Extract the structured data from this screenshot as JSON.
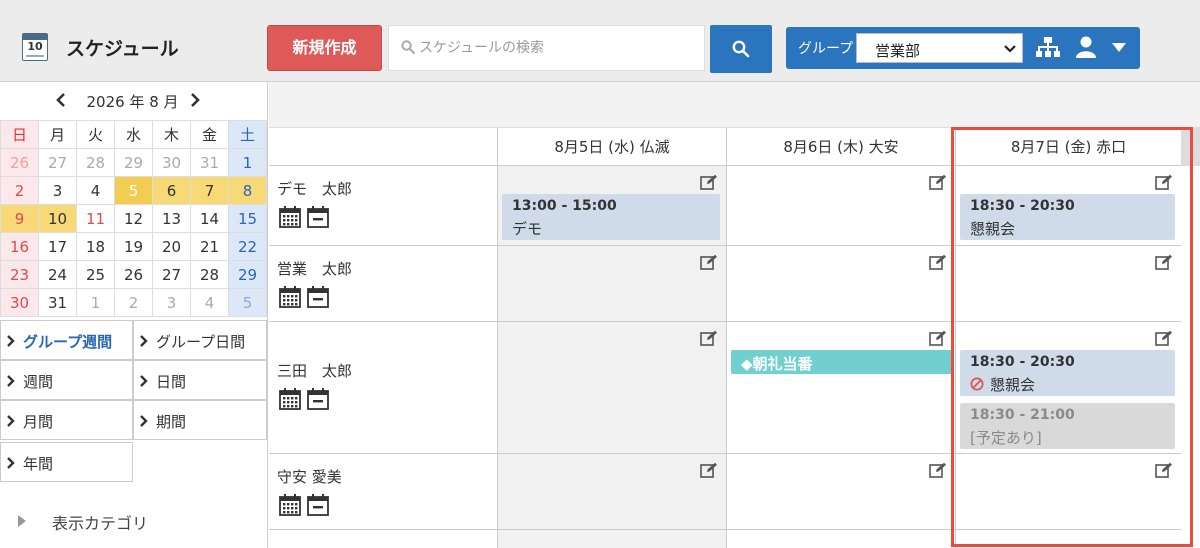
{
  "header": {
    "app_icon": {
      "name": "calendar-icon",
      "day": "10"
    },
    "title": "スケジュール",
    "new_button": "新規作成",
    "search": {
      "placeholder": "スケジュールの検索",
      "value": ""
    },
    "group_label": "グループ",
    "group_value": "営業部"
  },
  "mini_calendar": {
    "year": "2026",
    "month": "8",
    "label": "2026 年 8 月",
    "weekdays": [
      "日",
      "月",
      "火",
      "水",
      "木",
      "金",
      "土"
    ],
    "weeks": [
      [
        "26",
        "27",
        "28",
        "29",
        "30",
        "31",
        "1"
      ],
      [
        "2",
        "3",
        "4",
        "5",
        "6",
        "7",
        "8"
      ],
      [
        "9",
        "10",
        "11",
        "12",
        "13",
        "14",
        "15"
      ],
      [
        "16",
        "17",
        "18",
        "19",
        "20",
        "21",
        "22"
      ],
      [
        "23",
        "24",
        "25",
        "26",
        "27",
        "28",
        "29"
      ],
      [
        "30",
        "31",
        "1",
        "2",
        "3",
        "4",
        "5"
      ]
    ]
  },
  "view_menu": {
    "group_week": "グループ週間",
    "group_day": "グループ日間",
    "week": "週間",
    "day": "日間",
    "month": "月間",
    "period": "期間",
    "year": "年間"
  },
  "category_label": "表示カテゴリ",
  "days": [
    "8月5日 (水) 仏滅",
    "8月6日 (木) 大安",
    "8月7日 (金) 赤口"
  ],
  "rows": [
    {
      "name": "デモ　太郎",
      "events": {
        "d0": {
          "time": "13:00 - 15:00",
          "title": "デモ"
        },
        "d2": {
          "time": "18:30 - 20:30",
          "title": "懇親会"
        }
      }
    },
    {
      "name": "営業　太郎"
    },
    {
      "name": "三田　太郎",
      "events": {
        "d1": {
          "title": "◆朝礼当番"
        },
        "d2a": {
          "time": "18:30 - 20:30",
          "title": "懇親会"
        },
        "d2b": {
          "time": "18:30 - 21:00",
          "title": "[予定あり]"
        }
      }
    },
    {
      "name": "守安 愛美"
    }
  ],
  "colors": {
    "accent": "#2a75be",
    "new_button": "#dd5a59",
    "event_blue": "#cfdbe8",
    "event_teal": "#6fd0cf",
    "highlight": "#e74c3c",
    "week_highlight": "#f7d978"
  }
}
